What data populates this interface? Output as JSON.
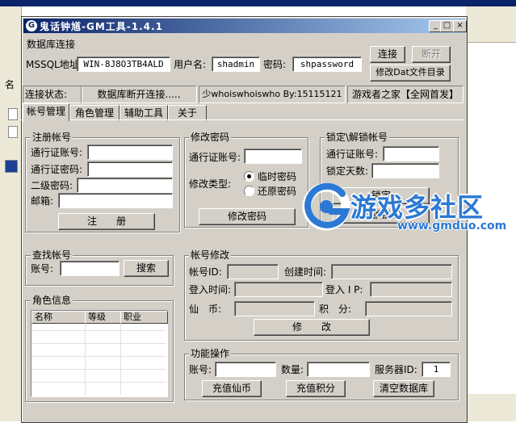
{
  "window": {
    "title": "鬼话钟馗-GM工具-1.4.1"
  },
  "background": {
    "left_header_char": "名"
  },
  "db": {
    "group_label": "数据库连接",
    "mssql_label": "MSSQL地址:",
    "mssql_value": "WIN-8J8O3TB4ALD",
    "user_label": "用户名:",
    "user_value": "shadmin",
    "pwd_label": "密码:",
    "pwd_value": "shpassword",
    "connect_button": "连接",
    "disconnect_button": "断开",
    "dat_button": "修改Dat文件目录"
  },
  "status": {
    "label": "连接状态:",
    "value": "数据库断开连接.....",
    "credit": "少whoiswhoiswho By:15115121",
    "site": "游戏者之家【全网首发】"
  },
  "tabs": [
    "帐号管理",
    "角色管理",
    "辅助工具",
    "关于"
  ],
  "register": {
    "group_label": "注册帐号",
    "account_label": "通行证账号:",
    "password_label": "通行证密码:",
    "second_pwd_label": "二级密码:",
    "email_label": "邮箱:",
    "submit_button": "注　　册"
  },
  "change_pwd": {
    "group_label": "修改密码",
    "account_label": "通行证账号:",
    "type_label": "修改类型:",
    "option_temp": "临时密码",
    "option_restore": "还原密码",
    "submit_button": "修改密码"
  },
  "lock": {
    "group_label": "锁定\\解锁帐号",
    "account_label": "通行证账号:",
    "days_label": "锁定天数:",
    "lock_button": "锁定",
    "unlock_button": "解锁锁定"
  },
  "search": {
    "group_label": "查找帐号",
    "account_label": "账号:",
    "search_button": "搜索"
  },
  "edit": {
    "group_label": "帐号修改",
    "id_label": "帐号ID:",
    "created_label": "创建时间:",
    "login_time_label": "登入时间:",
    "login_ip_label": "登入 I P:",
    "coin_label": "仙　币:",
    "points_label": "积　分:",
    "submit_button": "修　　改"
  },
  "roles": {
    "group_label": "角色信息",
    "columns": [
      "名称",
      "等级",
      "职业"
    ]
  },
  "func": {
    "group_label": "功能操作",
    "account_label": "账号:",
    "amount_label": "数量:",
    "server_label": "服务器ID:",
    "server_value": "1",
    "recharge_coin_button": "充值仙币",
    "recharge_points_button": "充值积分",
    "clear_db_button": "清空数据库"
  },
  "watermark": {
    "text": "游戏多社区",
    "url": "www.gmduo.com"
  },
  "colors": {
    "titlebar": "#0a246a",
    "face": "#d4d0c8",
    "watermark": "#2b79d4"
  }
}
